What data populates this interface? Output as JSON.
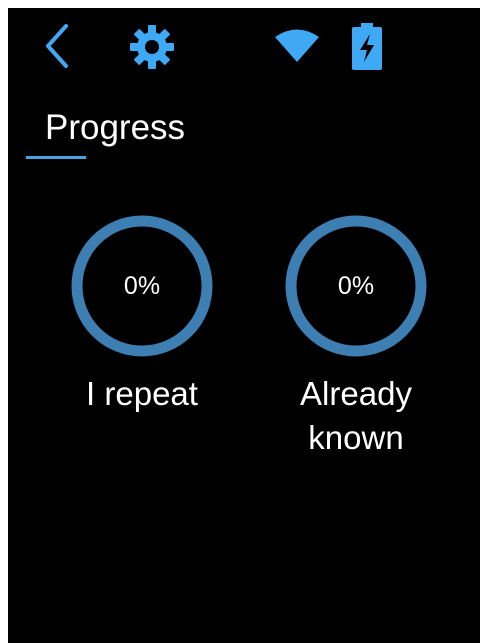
{
  "status_bar": {
    "back_icon": "chevron-left-icon",
    "settings_icon": "gear-icon",
    "wifi_icon": "wifi-icon",
    "battery_icon": "battery-charging-icon",
    "accent_color": "#3fa9f5"
  },
  "tab": {
    "title": "Progress",
    "underline_color": "#4aa3df"
  },
  "stats": [
    {
      "value": "0%",
      "progress": 0,
      "label": "I repeat"
    },
    {
      "value": "0%",
      "progress": 0,
      "label": "Already\nknown"
    }
  ],
  "ring_color": "#3d7fb2",
  "background_color": "#000000"
}
